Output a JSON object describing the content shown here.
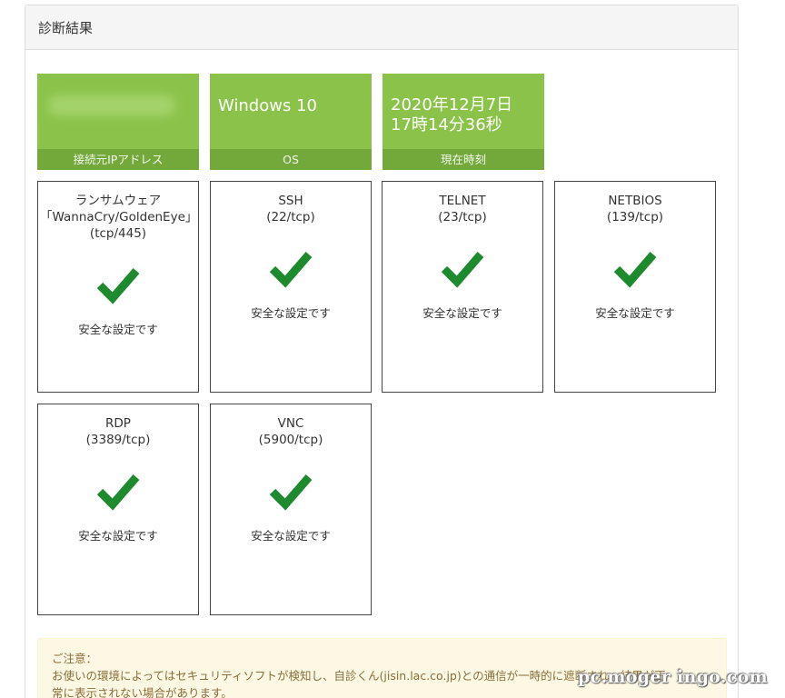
{
  "panel": {
    "title": "診断結果"
  },
  "info_tiles": [
    {
      "value": "",
      "label": "接続元IPアドレス"
    },
    {
      "value": "Windows 10",
      "label": "OS"
    },
    {
      "value_line1": "2020年12月7日",
      "value_line2": "17時14分36秒",
      "label": "現在時刻"
    }
  ],
  "services": [
    {
      "line1": "ランサムウェア",
      "line2": "「WannaCry/GoldenEye」",
      "line3": "(tcp/445)",
      "status": "安全な設定です"
    },
    {
      "line1": "SSH",
      "line2": "(22/tcp)",
      "status": "安全な設定です"
    },
    {
      "line1": "TELNET",
      "line2": "(23/tcp)",
      "status": "安全な設定です"
    },
    {
      "line1": "NETBIOS",
      "line2": "(139/tcp)",
      "status": "安全な設定です"
    },
    {
      "line1": "RDP",
      "line2": "(3389/tcp)",
      "status": "安全な設定です"
    },
    {
      "line1": "VNC",
      "line2": "(5900/tcp)",
      "status": "安全な設定です"
    }
  ],
  "notice": {
    "heading": "ご注意：",
    "line1": "お使いの環境によってはセキュリティソフトが検知し、自診くん(jisin.lac.co.jp)との通信が一時的に遮断され、結果が正",
    "line2": "常に表示されない場合があります。"
  },
  "watermark": "pc.moger ingo.com",
  "colors": {
    "tile_green": "#8bc34a",
    "tile_label_green": "#73a83a",
    "check_green": "#1e8a2e",
    "notice_bg": "#fcf8e3"
  },
  "icons": {
    "check": "check-icon"
  }
}
